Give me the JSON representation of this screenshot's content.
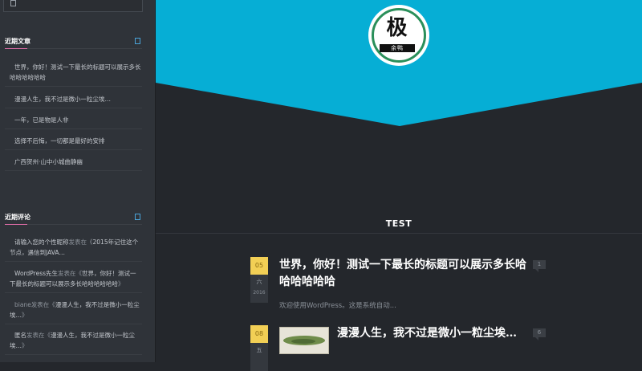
{
  "sidebar": {
    "search_placeholder": "",
    "recent_posts": {
      "title": "近期文章",
      "items": [
        "世界，你好！测试一下最长的标题可以展示多长哈哈哈哈哈哈",
        "漫漫人生，我不过是微小一粒尘埃…",
        "一年，已是物是人非",
        "选择不后悔，一切都是最好的安排",
        "广西贺州·山中小城曲静幽"
      ]
    },
    "recent_comments": {
      "title": "近期评论",
      "items": [
        {
          "author": "请输入您的个性昵称",
          "on": "发表在《",
          "post": "2015年记住这个节点，遇信到JAVA…",
          "close": ""
        },
        {
          "author": "WordPress先生",
          "on": "发表在《",
          "post": "世界，你好！测试一下最长的标题可以展示多长哈哈哈哈哈哈",
          "close": "》"
        },
        {
          "author": "biane",
          "on": "发表在《",
          "post": "漫漫人生，我不过是微小一粒尘埃…",
          "close": "》"
        },
        {
          "author": "匿名",
          "on": "发表在《",
          "post": "漫漫人生，我不过是微小一粒尘埃…",
          "close": "》"
        }
      ]
    }
  },
  "header": {
    "logo_glyph": "极",
    "logo_sub": "余鸭"
  },
  "main": {
    "section_label": "TEST",
    "posts": [
      {
        "day": "05",
        "weekday": "六",
        "year": "2016",
        "title": "世界，你好！测试一下最长的标题可以展示多长哈哈哈哈哈哈",
        "excerpt": "欢迎使用WordPress。这是系统自动...",
        "comments": "1"
      },
      {
        "day": "08",
        "weekday": "五",
        "year": "",
        "title": "漫漫人生，我不过是微小一粒尘埃…",
        "excerpt": "",
        "comments": "6"
      }
    ]
  },
  "colors": {
    "hero_blue": "#06aed5",
    "background": "#24272c",
    "sidebar": "#2f3339",
    "date_badge": "#f2cf55",
    "accent_pink": "#d86ba3",
    "logo_green": "#2a8f5a"
  }
}
